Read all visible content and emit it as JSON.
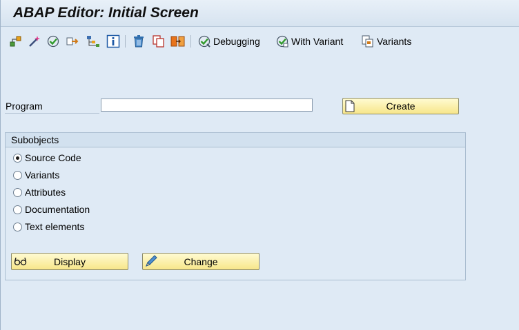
{
  "window": {
    "title": "ABAP Editor: Initial Screen"
  },
  "toolbar": {
    "icons": [
      "object-hierarchy-icon",
      "magic-wand-icon",
      "check-icon",
      "activate-icon",
      "where-used-icon",
      "object-list-icon",
      "info-icon",
      "trash-icon",
      "copy-icon",
      "rename-icon"
    ],
    "debugging_label": "Debugging",
    "with_variant_label": "With Variant",
    "variants_label": "Variants"
  },
  "program": {
    "label": "Program",
    "value": "",
    "create_label": "Create"
  },
  "subobjects": {
    "title": "Subobjects",
    "options": [
      {
        "label": "Source Code",
        "selected": true
      },
      {
        "label": "Variants",
        "selected": false
      },
      {
        "label": "Attributes",
        "selected": false
      },
      {
        "label": "Documentation",
        "selected": false
      },
      {
        "label": "Text elements",
        "selected": false
      }
    ],
    "display_label": "Display",
    "change_label": "Change"
  }
}
